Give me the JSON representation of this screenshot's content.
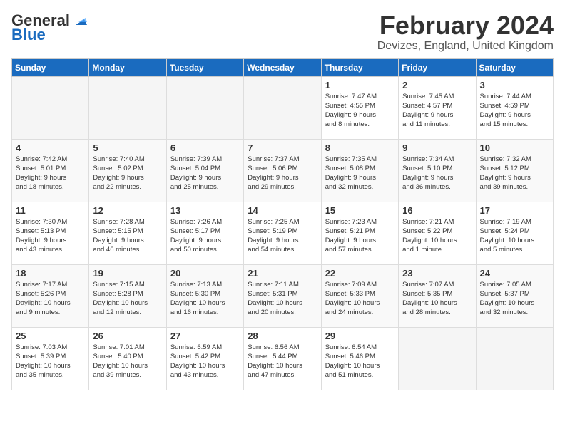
{
  "logo": {
    "general": "General",
    "blue": "Blue"
  },
  "title": "February 2024",
  "location": "Devizes, England, United Kingdom",
  "days_of_week": [
    "Sunday",
    "Monday",
    "Tuesday",
    "Wednesday",
    "Thursday",
    "Friday",
    "Saturday"
  ],
  "weeks": [
    [
      {
        "day": "",
        "info": ""
      },
      {
        "day": "",
        "info": ""
      },
      {
        "day": "",
        "info": ""
      },
      {
        "day": "",
        "info": ""
      },
      {
        "day": "1",
        "info": "Sunrise: 7:47 AM\nSunset: 4:55 PM\nDaylight: 9 hours\nand 8 minutes."
      },
      {
        "day": "2",
        "info": "Sunrise: 7:45 AM\nSunset: 4:57 PM\nDaylight: 9 hours\nand 11 minutes."
      },
      {
        "day": "3",
        "info": "Sunrise: 7:44 AM\nSunset: 4:59 PM\nDaylight: 9 hours\nand 15 minutes."
      }
    ],
    [
      {
        "day": "4",
        "info": "Sunrise: 7:42 AM\nSunset: 5:01 PM\nDaylight: 9 hours\nand 18 minutes."
      },
      {
        "day": "5",
        "info": "Sunrise: 7:40 AM\nSunset: 5:02 PM\nDaylight: 9 hours\nand 22 minutes."
      },
      {
        "day": "6",
        "info": "Sunrise: 7:39 AM\nSunset: 5:04 PM\nDaylight: 9 hours\nand 25 minutes."
      },
      {
        "day": "7",
        "info": "Sunrise: 7:37 AM\nSunset: 5:06 PM\nDaylight: 9 hours\nand 29 minutes."
      },
      {
        "day": "8",
        "info": "Sunrise: 7:35 AM\nSunset: 5:08 PM\nDaylight: 9 hours\nand 32 minutes."
      },
      {
        "day": "9",
        "info": "Sunrise: 7:34 AM\nSunset: 5:10 PM\nDaylight: 9 hours\nand 36 minutes."
      },
      {
        "day": "10",
        "info": "Sunrise: 7:32 AM\nSunset: 5:12 PM\nDaylight: 9 hours\nand 39 minutes."
      }
    ],
    [
      {
        "day": "11",
        "info": "Sunrise: 7:30 AM\nSunset: 5:13 PM\nDaylight: 9 hours\nand 43 minutes."
      },
      {
        "day": "12",
        "info": "Sunrise: 7:28 AM\nSunset: 5:15 PM\nDaylight: 9 hours\nand 46 minutes."
      },
      {
        "day": "13",
        "info": "Sunrise: 7:26 AM\nSunset: 5:17 PM\nDaylight: 9 hours\nand 50 minutes."
      },
      {
        "day": "14",
        "info": "Sunrise: 7:25 AM\nSunset: 5:19 PM\nDaylight: 9 hours\nand 54 minutes."
      },
      {
        "day": "15",
        "info": "Sunrise: 7:23 AM\nSunset: 5:21 PM\nDaylight: 9 hours\nand 57 minutes."
      },
      {
        "day": "16",
        "info": "Sunrise: 7:21 AM\nSunset: 5:22 PM\nDaylight: 10 hours\nand 1 minute."
      },
      {
        "day": "17",
        "info": "Sunrise: 7:19 AM\nSunset: 5:24 PM\nDaylight: 10 hours\nand 5 minutes."
      }
    ],
    [
      {
        "day": "18",
        "info": "Sunrise: 7:17 AM\nSunset: 5:26 PM\nDaylight: 10 hours\nand 9 minutes."
      },
      {
        "day": "19",
        "info": "Sunrise: 7:15 AM\nSunset: 5:28 PM\nDaylight: 10 hours\nand 12 minutes."
      },
      {
        "day": "20",
        "info": "Sunrise: 7:13 AM\nSunset: 5:30 PM\nDaylight: 10 hours\nand 16 minutes."
      },
      {
        "day": "21",
        "info": "Sunrise: 7:11 AM\nSunset: 5:31 PM\nDaylight: 10 hours\nand 20 minutes."
      },
      {
        "day": "22",
        "info": "Sunrise: 7:09 AM\nSunset: 5:33 PM\nDaylight: 10 hours\nand 24 minutes."
      },
      {
        "day": "23",
        "info": "Sunrise: 7:07 AM\nSunset: 5:35 PM\nDaylight: 10 hours\nand 28 minutes."
      },
      {
        "day": "24",
        "info": "Sunrise: 7:05 AM\nSunset: 5:37 PM\nDaylight: 10 hours\nand 32 minutes."
      }
    ],
    [
      {
        "day": "25",
        "info": "Sunrise: 7:03 AM\nSunset: 5:39 PM\nDaylight: 10 hours\nand 35 minutes."
      },
      {
        "day": "26",
        "info": "Sunrise: 7:01 AM\nSunset: 5:40 PM\nDaylight: 10 hours\nand 39 minutes."
      },
      {
        "day": "27",
        "info": "Sunrise: 6:59 AM\nSunset: 5:42 PM\nDaylight: 10 hours\nand 43 minutes."
      },
      {
        "day": "28",
        "info": "Sunrise: 6:56 AM\nSunset: 5:44 PM\nDaylight: 10 hours\nand 47 minutes."
      },
      {
        "day": "29",
        "info": "Sunrise: 6:54 AM\nSunset: 5:46 PM\nDaylight: 10 hours\nand 51 minutes."
      },
      {
        "day": "",
        "info": ""
      },
      {
        "day": "",
        "info": ""
      }
    ]
  ]
}
